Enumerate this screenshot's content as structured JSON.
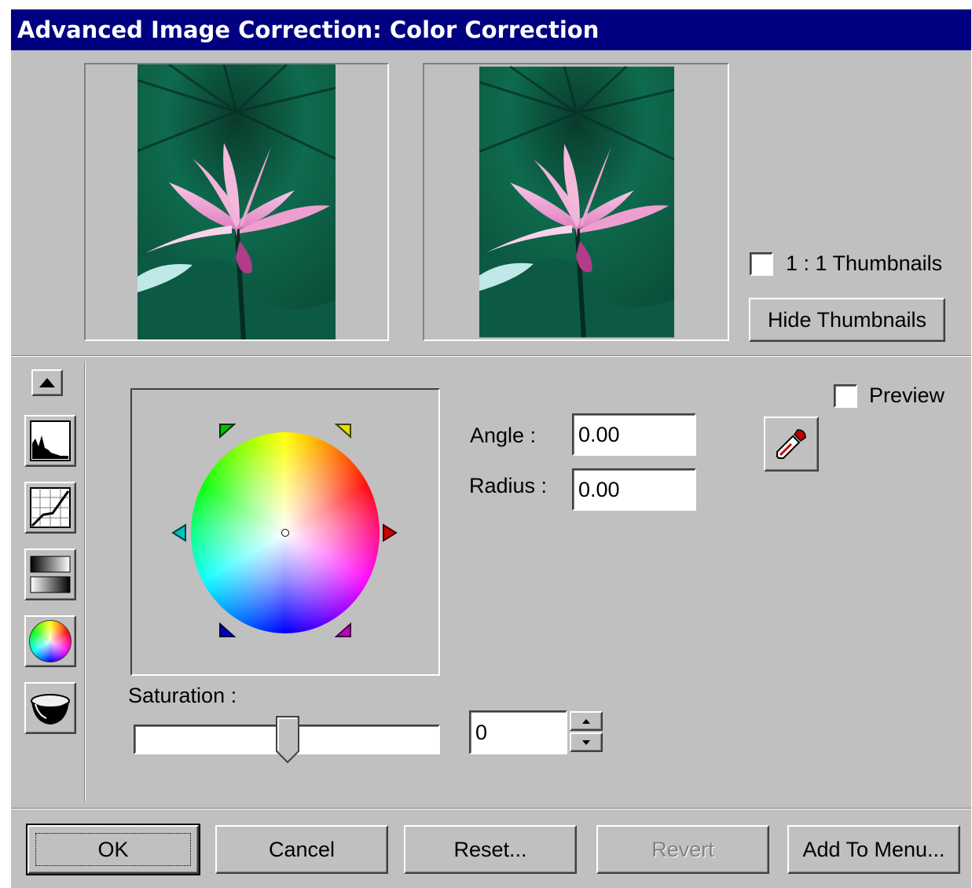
{
  "dialog": {
    "title": "Advanced Image Correction: Color Correction"
  },
  "thumbnails": {
    "one_to_one_label": "1 : 1 Thumbnails",
    "one_to_one_checked": false,
    "hide_button_label": "Hide Thumbnails"
  },
  "tools": {
    "items": [
      {
        "name": "histogram-tool-icon"
      },
      {
        "name": "curves-tool-icon"
      },
      {
        "name": "tone-gradient-tool-icon"
      },
      {
        "name": "color-wheel-tool-icon"
      },
      {
        "name": "bowl-tool-icon"
      }
    ]
  },
  "color_correction": {
    "angle_label": "Angle :",
    "angle_value": "0.00",
    "radius_label": "Radius :",
    "radius_value": "0.00",
    "preview_label": "Preview",
    "preview_checked": false,
    "saturation_label": "Saturation :",
    "saturation_value": "0"
  },
  "buttons": {
    "ok": "OK",
    "cancel": "Cancel",
    "reset": "Reset...",
    "revert": "Revert",
    "add_to_menu": "Add To Menu..."
  },
  "colors": {
    "title_bar": "#000080",
    "face": "#c0c0c0",
    "leaf_green": "#0f6a4a",
    "petal_pink": "#f2a9d6"
  }
}
